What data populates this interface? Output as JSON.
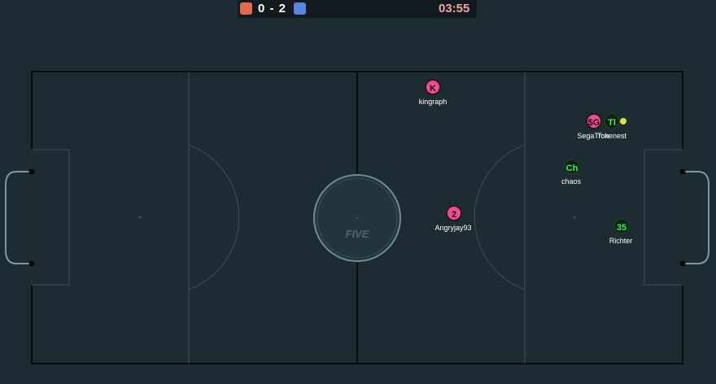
{
  "scoreboard": {
    "red_color": "#e26a50",
    "blue_color": "#5b86e0",
    "score": "0 - 2",
    "timer": "03:55"
  },
  "field": {
    "logo_text": "FIVE"
  },
  "players": [
    {
      "id": "kingraph",
      "initials": "K",
      "name": "kingraph",
      "team": "red"
    },
    {
      "id": "segatron",
      "initials": "$G",
      "name": "SegaTron",
      "team": "red"
    },
    {
      "id": "tokenest",
      "initials": "Tl",
      "name": "Tokenest",
      "team": "blue"
    },
    {
      "id": "chaos",
      "initials": "Ch",
      "name": "chaos",
      "team": "blue"
    },
    {
      "id": "angryjay",
      "initials": "2",
      "name": "Angryjay93",
      "team": "red"
    },
    {
      "id": "richter",
      "initials": "35",
      "name": "Richter",
      "team": "blue"
    }
  ]
}
